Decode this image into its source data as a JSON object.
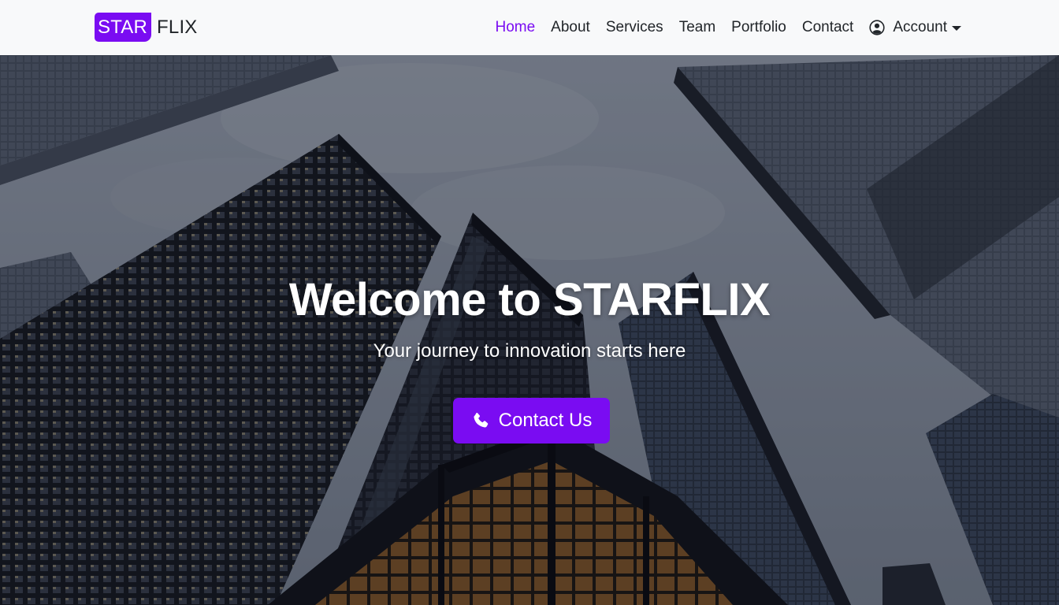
{
  "brand": {
    "part1": "STAR",
    "part2": "FLIX",
    "accent_color": "#7a0cf2"
  },
  "nav": {
    "items": [
      {
        "label": "Home",
        "active": true
      },
      {
        "label": "About",
        "active": false
      },
      {
        "label": "Services",
        "active": false
      },
      {
        "label": "Team",
        "active": false
      },
      {
        "label": "Portfolio",
        "active": false
      },
      {
        "label": "Contact",
        "active": false
      }
    ],
    "account": {
      "label": "Account",
      "icon": "user-circle-icon"
    }
  },
  "hero": {
    "title": "Welcome to STARFLIX",
    "subtitle": "Your journey to innovation starts here",
    "cta": {
      "label": "Contact Us",
      "icon": "phone-icon"
    },
    "background": "skyscrapers-photo"
  }
}
